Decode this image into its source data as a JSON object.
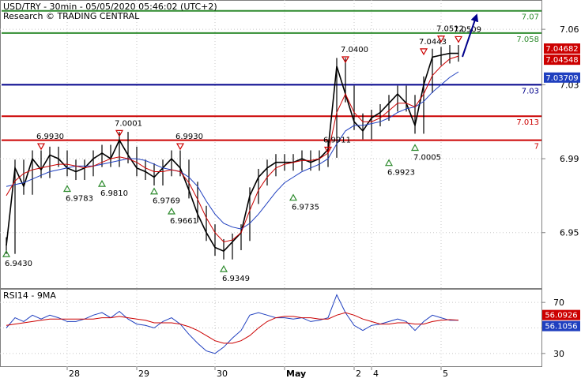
{
  "header": {
    "line1": "USD/TRY - 30min - 05/05/2020 05:46:02 (UTC+2)",
    "line2": "Research © TRADING CENTRAL"
  },
  "colors": {
    "price": "#000000",
    "ma_fast": "#cc0000",
    "ma_slow": "#1f3fbf",
    "resistance": "#2e8b2e",
    "pivot": "#00008b",
    "support": "#cc0000",
    "arrow": "#00008b",
    "grid": "#c8c8c8"
  },
  "price_panel": {
    "y_ticks": [
      "7.06",
      "7.03",
      "6.99",
      "6.95"
    ],
    "price_badges": [
      {
        "label": "7.04682",
        "value": 7.04682,
        "bg": "#cc0000"
      },
      {
        "label": "7.04548",
        "value": 7.04548,
        "bg": "#cc0000"
      },
      {
        "label": "7.03709",
        "value": 7.03709,
        "bg": "#1f3fbf"
      }
    ]
  },
  "rsi_panel": {
    "title": "RSI14 - 9MA",
    "y_ticks": [
      "70",
      "50",
      "30"
    ],
    "badges": [
      {
        "label": "56.0926",
        "value": 56.0926,
        "bg": "#cc0000"
      },
      {
        "label": "56.1056",
        "value": 56.1056,
        "bg": "#1f3fbf"
      }
    ]
  },
  "x_axis": {
    "labels": [
      "28",
      "29",
      "30",
      "May",
      "2",
      "4",
      "5"
    ]
  },
  "chart_data": [
    {
      "type": "line",
      "y_range": [
        6.92,
        7.075
      ],
      "horizontal_levels": [
        {
          "label": "7.07",
          "value": 7.07,
          "role": "resistance"
        },
        {
          "label": "7.058",
          "value": 7.058,
          "role": "resistance"
        },
        {
          "label": "7.03",
          "value": 7.03,
          "role": "pivot"
        },
        {
          "label": "7.013",
          "value": 7.013,
          "role": "support"
        },
        {
          "label": "7",
          "value": 7.0,
          "role": "support"
        }
      ],
      "annotations": [
        {
          "label": "6.9430",
          "kind": "low",
          "value": 6.943
        },
        {
          "label": "6.9930",
          "kind": "high",
          "value": 6.993
        },
        {
          "label": "6.9783",
          "kind": "low",
          "value": 6.9783
        },
        {
          "label": "6.9810",
          "kind": "low",
          "value": 6.981
        },
        {
          "label": "7.0001",
          "kind": "high",
          "value": 7.0001
        },
        {
          "label": "6.9769",
          "kind": "low",
          "value": 6.9769
        },
        {
          "label": "6.9661",
          "kind": "low",
          "value": 6.9661
        },
        {
          "label": "6.9930",
          "kind": "high",
          "value": 6.993
        },
        {
          "label": "6.9349",
          "kind": "low",
          "value": 6.9349
        },
        {
          "label": "6.9735",
          "kind": "low",
          "value": 6.9735
        },
        {
          "label": "6.9911",
          "kind": "high",
          "value": 6.9911
        },
        {
          "label": "7.0400",
          "kind": "high",
          "value": 7.04
        },
        {
          "label": "6.9923",
          "kind": "low",
          "value": 6.9923
        },
        {
          "label": "7.0443",
          "kind": "high",
          "value": 7.0443
        },
        {
          "label": "7.0005",
          "kind": "low",
          "value": 7.0005
        },
        {
          "label": "7.0512",
          "kind": "high",
          "value": 7.0512
        },
        {
          "label": "7.0509",
          "kind": "high",
          "value": 7.0509
        }
      ],
      "series": [
        {
          "name": "price",
          "values": [
            6.943,
            6.985,
            6.975,
            6.99,
            6.984,
            6.992,
            6.99,
            6.985,
            6.983,
            6.985,
            6.99,
            6.993,
            6.99,
            7.0,
            6.992,
            6.985,
            6.983,
            6.98,
            6.985,
            6.99,
            6.985,
            6.973,
            6.96,
            6.95,
            6.942,
            6.94,
            6.945,
            6.95,
            6.97,
            6.98,
            6.985,
            6.988,
            6.988,
            6.988,
            6.99,
            6.988,
            6.99,
            6.995,
            7.04,
            7.025,
            7.01,
            7.005,
            7.012,
            7.015,
            7.02,
            7.025,
            7.02,
            7.008,
            7.03,
            7.045,
            7.046,
            7.047,
            7.047
          ]
        },
        {
          "name": "ma_fast",
          "values": [
            6.97,
            6.978,
            6.982,
            6.984,
            6.985,
            6.986,
            6.987,
            6.987,
            6.986,
            6.985,
            6.986,
            6.988,
            6.99,
            6.991,
            6.99,
            6.988,
            6.985,
            6.983,
            6.983,
            6.984,
            6.983,
            6.977,
            6.968,
            6.958,
            6.95,
            6.945,
            6.946,
            6.95,
            6.962,
            6.973,
            6.98,
            6.985,
            6.987,
            6.988,
            6.989,
            6.989,
            6.99,
            6.993,
            7.015,
            7.025,
            7.015,
            7.01,
            7.01,
            7.012,
            7.016,
            7.02,
            7.02,
            7.018,
            7.025,
            7.035,
            7.04,
            7.044,
            7.0455
          ]
        },
        {
          "name": "ma_slow",
          "values": [
            6.975,
            6.976,
            6.977,
            6.979,
            6.981,
            6.983,
            6.984,
            6.985,
            6.986,
            6.986,
            6.986,
            6.987,
            6.988,
            6.989,
            6.99,
            6.99,
            6.989,
            6.987,
            6.985,
            6.984,
            6.983,
            6.98,
            6.975,
            6.967,
            6.96,
            6.955,
            6.953,
            6.952,
            6.955,
            6.96,
            6.966,
            6.972,
            6.977,
            6.98,
            6.983,
            6.985,
            6.987,
            6.99,
            6.998,
            7.005,
            7.008,
            7.008,
            7.009,
            7.01,
            7.012,
            7.015,
            7.017,
            7.018,
            7.021,
            7.026,
            7.03,
            7.034,
            7.037
          ]
        }
      ]
    },
    {
      "type": "line",
      "y_range": [
        20,
        80
      ],
      "series": [
        {
          "name": "rsi",
          "values": [
            50,
            58,
            55,
            60,
            57,
            60,
            58,
            55,
            55,
            57,
            60,
            62,
            58,
            63,
            57,
            53,
            52,
            50,
            55,
            58,
            53,
            45,
            38,
            32,
            30,
            35,
            42,
            48,
            60,
            62,
            60,
            58,
            58,
            57,
            58,
            55,
            56,
            58,
            76,
            62,
            52,
            48,
            52,
            53,
            55,
            57,
            55,
            48,
            55,
            60,
            58,
            56,
            56
          ]
        },
        {
          "name": "rsi_ma",
          "values": [
            52,
            53,
            54,
            55,
            56,
            57,
            57,
            57,
            57,
            57,
            57,
            58,
            58,
            59,
            58,
            57,
            56,
            54,
            54,
            54,
            53,
            51,
            48,
            44,
            40,
            38,
            38,
            40,
            44,
            50,
            55,
            58,
            59,
            59,
            58,
            58,
            57,
            57,
            60,
            62,
            60,
            57,
            55,
            53,
            53,
            54,
            54,
            53,
            53,
            55,
            56,
            56.5,
            56.1
          ]
        }
      ]
    }
  ]
}
